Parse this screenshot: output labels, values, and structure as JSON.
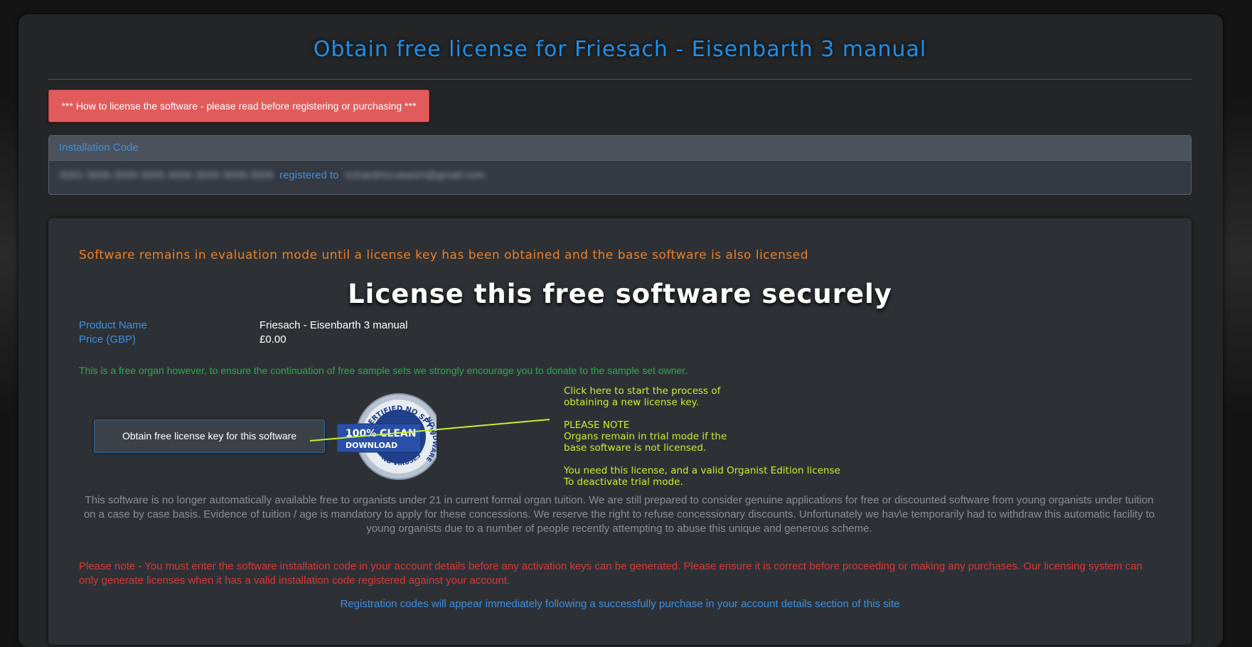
{
  "header": {
    "title": "Obtain free license for Friesach - Eisenbarth 3 manual",
    "how_to_button": "*** How to license the software - please read before registering or purchasing ***"
  },
  "installation": {
    "heading": "Installation Code",
    "code": "3001-3006-3556-3005-3006-3005-3006-3006",
    "registered_to_label": "registered to",
    "email": "richardmccaworn@gmail.com"
  },
  "main": {
    "evaluation_warning": "Software remains in evaluation mode until a license key has been obtained and the base software is also licensed",
    "heading": "License this free software securely",
    "product": {
      "name_label": "Product Name",
      "name_value": "Friesach - Eisenbarth 3 manual",
      "price_label": "Price (GBP)",
      "price_value": "£0.00"
    },
    "donate_text": "This is a free organ however, to ensure the continuation of free sample sets we strongly encourage you to donate to the sample set owner.",
    "obtain_button": "Obtain free license key for this software",
    "badge": {
      "top": "CERTIFIED NO SPYWARE",
      "middle_1": "100% CLEAN",
      "middle_2": "DOWNLOAD",
      "right": "NO ADWARE",
      "bottom": "NO VIRUSES"
    },
    "callout": {
      "line1": "Click here to start the process of",
      "line2": "obtaining a new license key.",
      "line3": "PLEASE NOTE",
      "line4": "Organs remain in trial mode if the",
      "line5": "base software is not licensed.",
      "line6": "You need this license, and a valid Organist Edition license",
      "line7": "To deactivate trial mode."
    },
    "policy_text": "This software is no longer automatically available free to organists under 21 in current formal organ tuition. We are still prepared to consider genuine applications for free or discounted software from young organists under tuition on a case by case basis. Evidence of tuition / age is mandatory to apply for these concessions. We reserve the right to refuse concessionary discounts. Unfortunately we hav\\e temporarily had to withdraw this automatic facility to young organists due to a number of people recently attempting to abuse this unique and generous scheme.",
    "please_note": "Please note - You must enter the software installation code in your account details before any activation keys can be generated. Please ensure it is correct before proceeding or making any purchases. Our licensing system can only generate licenses when it has a valid installation code registered against your account.",
    "registration_codes": "Registration codes will appear immediately following a successfully purchase in your account details section of this site"
  },
  "colors": {
    "accent_blue": "#1d8fe8",
    "warning_orange": "#f07f22",
    "alert_red": "#e25b5b",
    "donate_green": "#2fa94a",
    "callout_yellow_green": "#c8f02a"
  }
}
